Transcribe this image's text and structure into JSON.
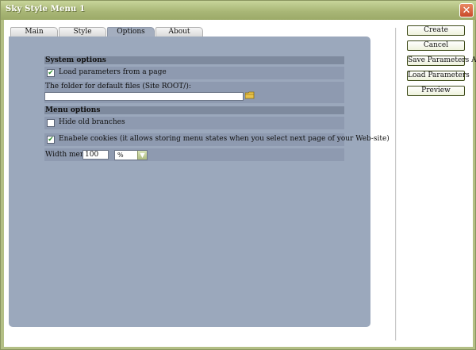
{
  "window": {
    "title": "Sky Style Menu 1"
  },
  "tabs": [
    {
      "label": "Main",
      "active": false
    },
    {
      "label": "Style",
      "active": false
    },
    {
      "label": "Options",
      "active": true
    },
    {
      "label": "About",
      "active": false
    }
  ],
  "system_options": {
    "heading": "System options",
    "load_params": {
      "label": "Load parameters from a page",
      "checked": true
    },
    "folder": {
      "label": "The folder for default files (Site ROOT/):",
      "value": ""
    }
  },
  "menu_options": {
    "heading": "Menu options",
    "hide_branches": {
      "label": "Hide old branches",
      "checked": false
    },
    "enable_cookies": {
      "label": "Enabele cookies (it allows storing menu states when you select next page of your Web-site)",
      "checked": true
    },
    "width": {
      "label": "Width menu:",
      "value": "100",
      "unit": "%"
    }
  },
  "buttons": {
    "create": "Create",
    "cancel": "Cancel",
    "save_params": "Save Parameters As",
    "load_params": "Load Parameters",
    "preview": "Preview"
  },
  "icons": {
    "close": "close-icon",
    "folder": "folder-icon",
    "check": "check-icon",
    "dropdown": "chevron-down-icon"
  },
  "colors": {
    "titlebar": "#a9b777",
    "panel": "#9ba8bc",
    "row": "#8e9ab0",
    "section": "#7e8a9e",
    "close": "#c8492a"
  }
}
